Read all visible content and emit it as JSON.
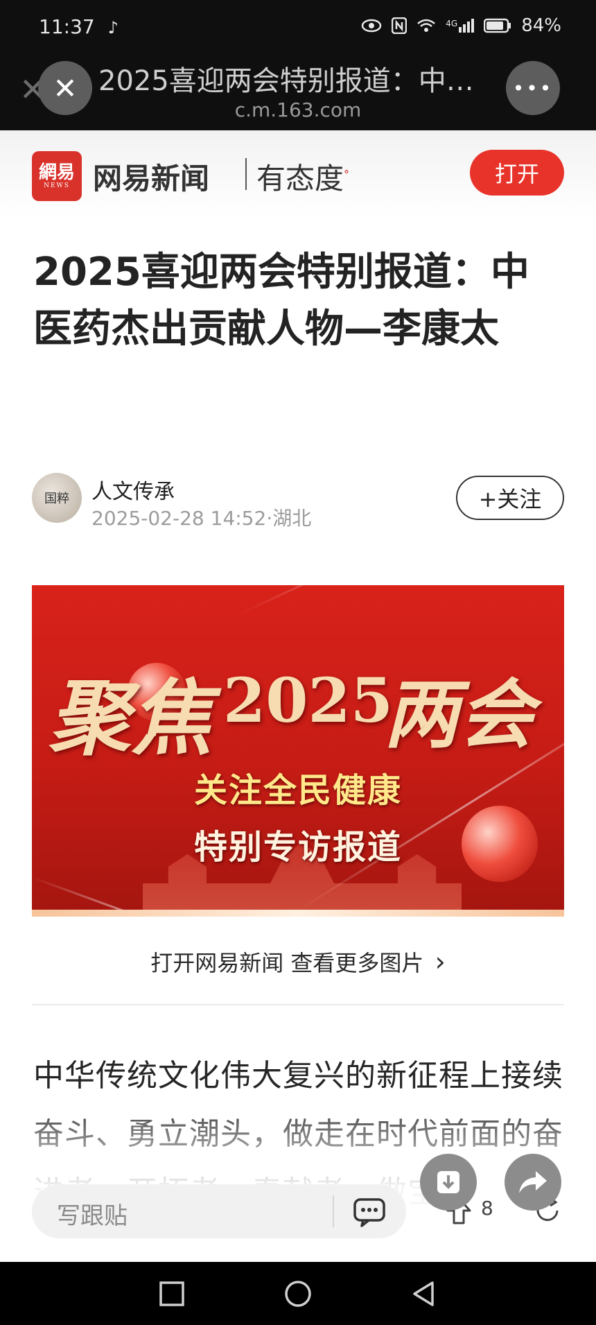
{
  "status_bar": {
    "time": "11:37",
    "tiktok_glyph": "♪",
    "battery": "84%",
    "icons": [
      "eye-icon",
      "nfc-icon",
      "wifi-icon",
      "4g-signal-icon",
      "battery-icon"
    ],
    "network_label": "4G"
  },
  "browser": {
    "title": "2025喜迎两会特别报道：中…",
    "url": "c.m.163.com",
    "close_glyph": "✕",
    "more_glyph": "•••"
  },
  "app_header": {
    "logo_text": "網易",
    "logo_sub": "NEWS",
    "brand_name": "网易新闻",
    "slogan": "有态度",
    "slogan_mark": "°",
    "open_label": "打开"
  },
  "article": {
    "title": "2025喜迎两会特别报道：中医药杰出贡献人物—李康太",
    "author": "人文传承",
    "avatar_text": "国粹",
    "meta": "2025-02-28 14:52·湖北",
    "follow_label": "+关注",
    "banner": {
      "headline_a": "聚焦",
      "headline_b": "2025",
      "headline_c": "两会",
      "sub1": "关注全民健康",
      "sub2": "特别专访报道"
    },
    "more_pictures": "打开网易新闻 查看更多图片",
    "more_chevron": "›",
    "body_text": "中华传统文化伟大复兴的新征程上接续奋斗、勇立潮头，做走在时代前面的奋进者、开拓者、奉献者，做宝珠"
  },
  "bottom_bar": {
    "reply_placeholder": "写跟贴",
    "share_count": "8"
  },
  "colors": {
    "accent": "#e8332a",
    "banner_red": "#d8221a",
    "text_dark": "#232323",
    "text_muted": "#9b9b9b"
  }
}
